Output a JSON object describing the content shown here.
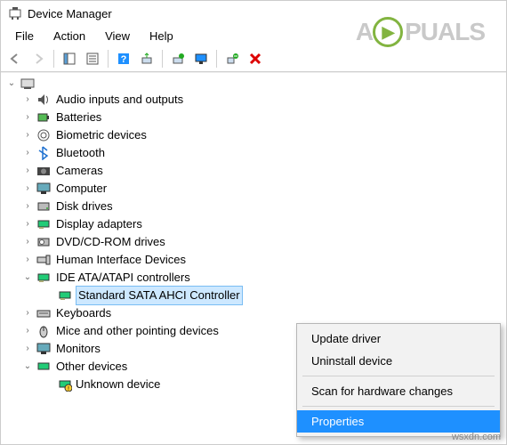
{
  "window": {
    "title": "Device Manager"
  },
  "menubar": {
    "file": "File",
    "action": "Action",
    "view": "View",
    "help": "Help"
  },
  "toolbar": {
    "back": "back",
    "forward": "forward",
    "up": "up",
    "props": "properties",
    "help": "help",
    "scan": "scan",
    "update": "update",
    "monitor": "monitor",
    "uninstall": "uninstall",
    "remove": "remove"
  },
  "tree": {
    "root": "",
    "items": [
      {
        "label": "Audio inputs and outputs",
        "expanded": false
      },
      {
        "label": "Batteries",
        "expanded": false
      },
      {
        "label": "Biometric devices",
        "expanded": false
      },
      {
        "label": "Bluetooth",
        "expanded": false
      },
      {
        "label": "Cameras",
        "expanded": false
      },
      {
        "label": "Computer",
        "expanded": false
      },
      {
        "label": "Disk drives",
        "expanded": false
      },
      {
        "label": "Display adapters",
        "expanded": false
      },
      {
        "label": "DVD/CD-ROM drives",
        "expanded": false
      },
      {
        "label": "Human Interface Devices",
        "expanded": false
      },
      {
        "label": "IDE ATA/ATAPI controllers",
        "expanded": true,
        "children": [
          {
            "label": "Standard SATA AHCI Controller",
            "selected": true
          }
        ]
      },
      {
        "label": "Keyboards",
        "expanded": false
      },
      {
        "label": "Mice and other pointing devices",
        "expanded": false
      },
      {
        "label": "Monitors",
        "expanded": false
      },
      {
        "label": "Other devices",
        "expanded": true,
        "children": [
          {
            "label": "Unknown device",
            "selected": false,
            "warn": true
          }
        ]
      }
    ]
  },
  "context_menu": {
    "update": "Update driver",
    "uninstall": "Uninstall device",
    "scan": "Scan for hardware changes",
    "properties": "Properties"
  },
  "watermark": {
    "text_left": "A",
    "text_right": "PUALS"
  },
  "footer": {
    "source": "wsxdn.com"
  }
}
